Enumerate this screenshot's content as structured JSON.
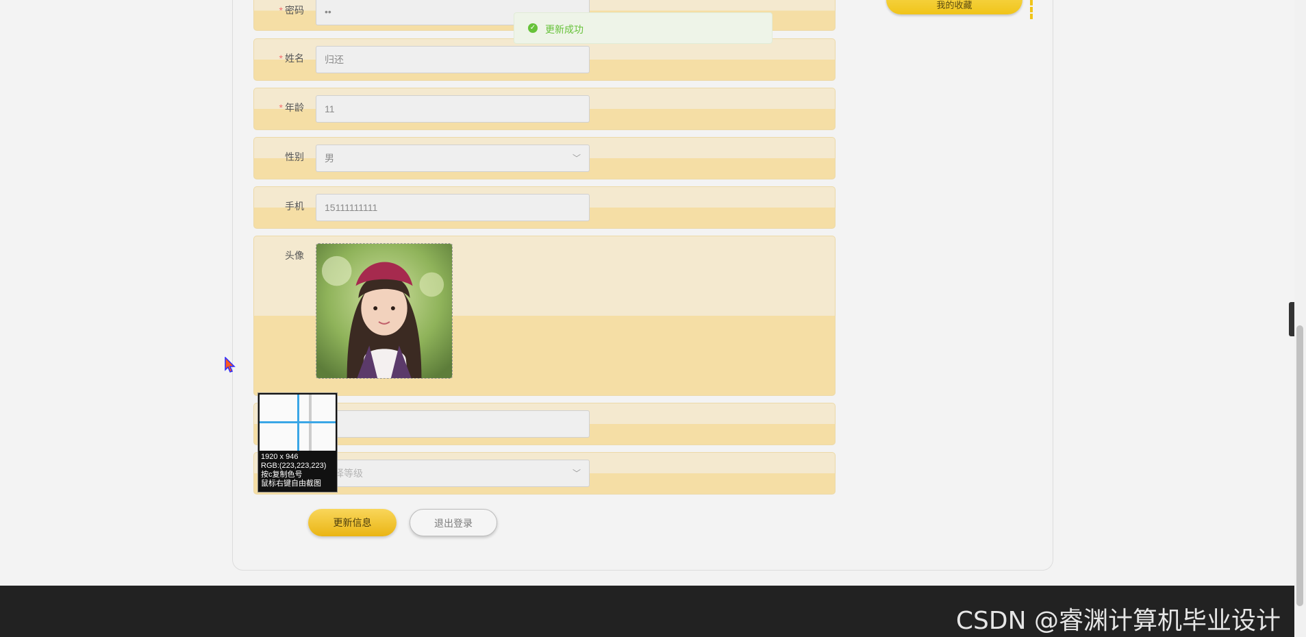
{
  "toast": {
    "message": "更新成功",
    "icon": "check-circle-icon"
  },
  "sidebar": {
    "favorites_button": "我的收藏"
  },
  "form": {
    "password": {
      "label": "密码",
      "value": "••",
      "required": true
    },
    "name": {
      "label": "姓名",
      "value": "归还",
      "required": true
    },
    "age": {
      "label": "年龄",
      "value": "11",
      "required": true
    },
    "gender": {
      "label": "性别",
      "value": "男"
    },
    "phone": {
      "label": "手机",
      "value": "15111111111"
    },
    "avatar": {
      "label": "头像"
    },
    "level": {
      "placeholder": "选择等级"
    }
  },
  "actions": {
    "update": "更新信息",
    "logout": "退出登录"
  },
  "color_picker": {
    "size": "1920 x 946",
    "rgb": "RGB:(223,223,223)",
    "hint1": "按c复制色号",
    "hint2": "鼠标右键自由截图"
  },
  "footer": {
    "watermark": "CSDN @睿渊计算机毕业设计"
  },
  "colors": {
    "accent": "#f0c419",
    "success": "#67c23a",
    "required": "#f56c6c"
  }
}
